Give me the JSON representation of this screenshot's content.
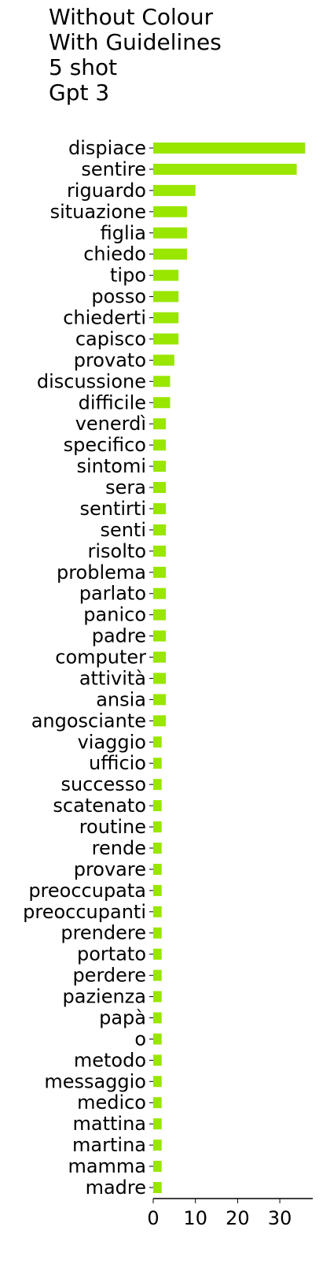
{
  "chart_data": {
    "type": "bar",
    "orientation": "horizontal",
    "title_lines": [
      "Without Colour",
      "With Guidelines",
      "5 shot",
      "Gpt 3"
    ],
    "categories": [
      "dispiace",
      "sentire",
      "riguardo",
      "situazione",
      "figlia",
      "chiedo",
      "tipo",
      "posso",
      "chiederti",
      "capisco",
      "provato",
      "discussione",
      "difficile",
      "venerdì",
      "specifico",
      "sintomi",
      "sera",
      "sentirti",
      "senti",
      "risolto",
      "problema",
      "parlato",
      "panico",
      "padre",
      "computer",
      "attività",
      "ansia",
      "angosciante",
      "viaggio",
      "ufficio",
      "successo",
      "scatenato",
      "routine",
      "rende",
      "provare",
      "preoccupata",
      "preoccupanti",
      "prendere",
      "portato",
      "perdere",
      "pazienza",
      "papà",
      "o",
      "metodo",
      "messaggio",
      "medico",
      "mattina",
      "martina",
      "mamma",
      "madre"
    ],
    "values": [
      36,
      34,
      10,
      8,
      8,
      8,
      6,
      6,
      6,
      6,
      5,
      4,
      4,
      3,
      3,
      3,
      3,
      3,
      3,
      3,
      3,
      3,
      3,
      3,
      3,
      3,
      3,
      3,
      2,
      2,
      2,
      2,
      2,
      2,
      2,
      2,
      2,
      2,
      2,
      2,
      2,
      2,
      2,
      2,
      2,
      2,
      2,
      2,
      2,
      2
    ],
    "xlim": [
      0,
      37.8
    ],
    "xticks": [
      0,
      10,
      20,
      30
    ],
    "xlabel": "",
    "ylabel": "",
    "grid": false,
    "bar_color": "#99e600"
  }
}
